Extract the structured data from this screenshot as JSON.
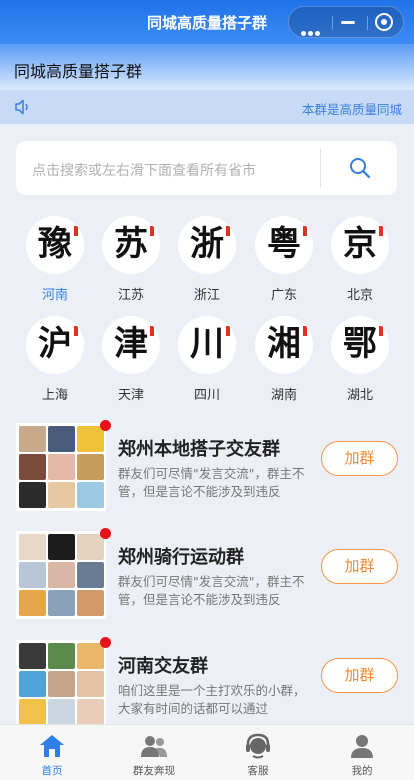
{
  "window": {
    "title": "同城高质量搭子群"
  },
  "header": {
    "group_name": "同城高质量搭子群"
  },
  "notice": {
    "text": "本群是高质量同城"
  },
  "search": {
    "placeholder": "点击搜索或左右滑下面查看所有省市"
  },
  "provinces": [
    {
      "glyph": "豫",
      "label": "河南",
      "active": true
    },
    {
      "glyph": "苏",
      "label": "江苏"
    },
    {
      "glyph": "浙",
      "label": "浙江"
    },
    {
      "glyph": "粤",
      "label": "广东"
    },
    {
      "glyph": "京",
      "label": "北京"
    },
    {
      "glyph": "沪",
      "label": "上海"
    },
    {
      "glyph": "津",
      "label": "天津"
    },
    {
      "glyph": "川",
      "label": "四川"
    },
    {
      "glyph": "湘",
      "label": "湖南"
    },
    {
      "glyph": "鄂",
      "label": "湖北"
    }
  ],
  "groups": [
    {
      "title": "郑州本地搭子交友群",
      "desc": "群友们可尽情\"发言交流\"，群主不管，但是言论不能涉及到违反",
      "button": "加群"
    },
    {
      "title": "郑州骑行运动群",
      "desc": "群友们可尽情\"发言交流\"，群主不管，但是言论不能涉及到违反",
      "button": "加群"
    },
    {
      "title": "河南交友群",
      "desc": "咱们这里是一个主打欢乐的小群，大家有时间的话都可以通过",
      "button": "加群"
    }
  ],
  "tabbar": [
    {
      "label": "首页",
      "icon": "home-icon",
      "active": true
    },
    {
      "label": "群友奔现",
      "icon": "users-icon"
    },
    {
      "label": "客服",
      "icon": "headset-icon"
    },
    {
      "label": "我的",
      "icon": "person-icon"
    }
  ],
  "colors": {
    "accent": "#2f7fe6",
    "join": "#f08a35",
    "badge": "#e8121b"
  }
}
